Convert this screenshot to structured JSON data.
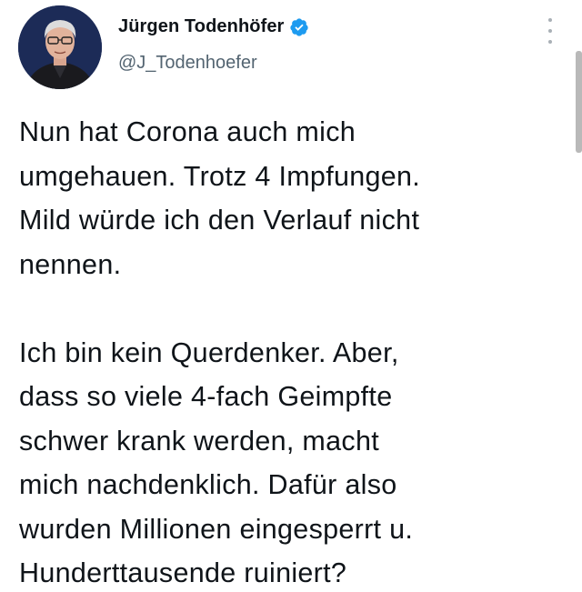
{
  "author": {
    "display_name": "Jürgen Todenhöfer",
    "handle": "@J_Todenhoefer",
    "verified": true,
    "verified_color": "#1d9bf0",
    "avatar_icon": "profile-photo"
  },
  "menu": {
    "icon": "more-vertical-icon"
  },
  "tweet": {
    "lines_para1": [
      "Nun hat Corona auch mich",
      "umgehauen. Trotz 4 Impfungen.",
      "Mild würde ich den Verlauf nicht",
      "nennen."
    ],
    "lines_para2": [
      "Ich bin kein Querdenker. Aber,",
      "dass so viele 4-fach Geimpfte",
      "schwer krank werden, macht",
      "mich nachdenklich. Dafür also",
      "wurden Millionen eingesperrt u.",
      "Hunderttausende ruiniert?"
    ]
  }
}
